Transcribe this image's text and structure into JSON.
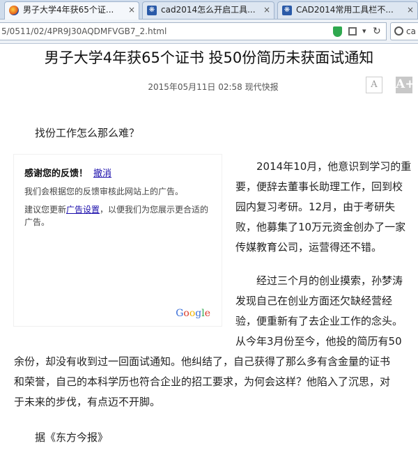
{
  "browser": {
    "tabs": [
      {
        "title": "男子大学4年获65个证...",
        "close": "×",
        "active": true
      },
      {
        "title": "cad2014怎么开启工具...",
        "close": "×",
        "active": false
      },
      {
        "title": "CAD2014常用工具栏不...",
        "close": "×",
        "active": false
      }
    ],
    "url": "5/0511/02/4PR9J30AQDMFVGB7_2.html",
    "search_text": "ca"
  },
  "article": {
    "title": "男子大学4年获65个证书 投50份简历未获面试通知",
    "date": "2015年05月11日",
    "time": "02:58",
    "source": "现代快报",
    "font_small": "A",
    "font_large": "A+",
    "lead": "找份工作怎么那么难？",
    "side_lines_1": [
      "2014年10月，他意识到学习的重",
      "要，便辞去董事长助理工作，回到校",
      "园内复习考研。12月，由于考研失",
      "败，他募集了10万元资金创办了一家",
      "传媒教育公司，运营得还不错。"
    ],
    "side_lines_2": [
      "经过三个月的创业摸索，孙梦涛",
      "发现自己在创业方面还欠缺经营经",
      "验，便重新有了去企业工作的念头。"
    ],
    "side_lines_3": [
      "从今年3月份至今，他投的简历有50"
    ],
    "full_lines": [
      "余份，却没有收到过一回面试通知。他纠结了，自己获得了那么多有含金量的证书",
      "和荣誉，自己的本科学历也符合企业的招工要求，为何会这样？他陷入了沉思，对",
      "于未来的步伐，有点迈不开脚。"
    ],
    "credit": "据《东方今报》"
  },
  "ad": {
    "heading": "感谢您的反馈！",
    "undo": "撤消",
    "line1": "我们会根据您的反馈审核此网站上的广告。",
    "line2_a": "建议您更新",
    "line2_link": "广告设置",
    "line2_b": "，以便我们为您展示更合适的广告。",
    "logo": "Google"
  },
  "colors": {
    "link": "#1a0dab",
    "shield": "#2fa84f"
  }
}
